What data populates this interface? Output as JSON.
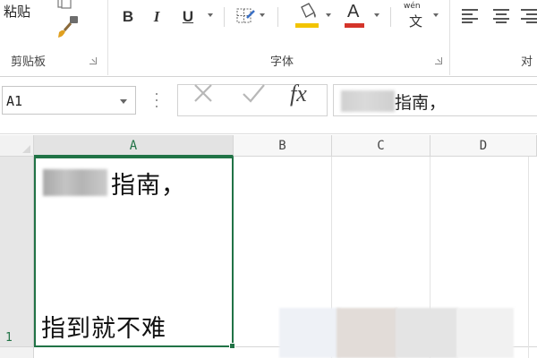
{
  "ribbon": {
    "clipboard": {
      "paste_label": "粘贴",
      "group_label": "剪贴板",
      "icons": [
        "copy-icon",
        "format-painter-icon"
      ]
    },
    "font": {
      "group_label": "字体",
      "bold": "B",
      "italic": "I",
      "underline": "U",
      "font_color_letter": "A",
      "phonetic_pinyin": "wén",
      "phonetic_char": "文",
      "icons": [
        "borders-icon",
        "fill-color-icon",
        "font-color-icon",
        "phonetic-guide-icon"
      ],
      "fill_color": "#f2c400",
      "font_color": "#d4342a"
    },
    "alignment": {
      "group_label_partial": "对",
      "icons": [
        "align-left-icon",
        "align-center-icon",
        "align-right-icon"
      ]
    }
  },
  "formula_bar": {
    "name_box": "A1",
    "cancel_icon": "cancel-icon",
    "enter_icon": "check-icon",
    "fx_label": "fx",
    "content_visible": "指南，"
  },
  "grid": {
    "columns": [
      "A",
      "B",
      "C",
      "D"
    ],
    "selected_column": "A",
    "rows": [
      "1"
    ],
    "cell_a1": {
      "line1_visible": "指南，",
      "line2": "指到就不难"
    },
    "accent_color": "#217346"
  }
}
